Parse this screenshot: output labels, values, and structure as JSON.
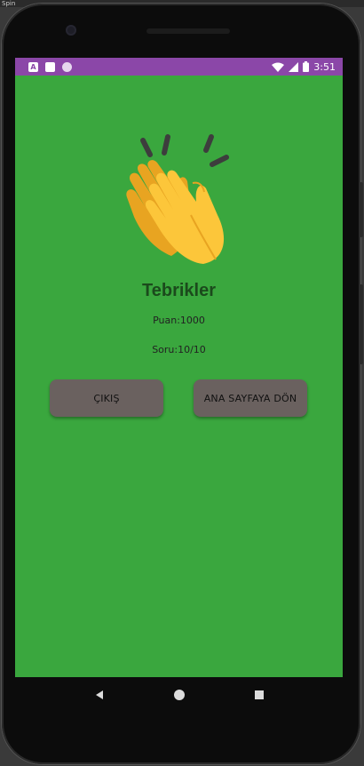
{
  "window": {
    "top_strip_label": "Spin"
  },
  "status_bar": {
    "time": "3:51",
    "notification_icons": [
      "a-letter-icon",
      "sd-card-icon",
      "sync-circle-icon"
    ],
    "system_icons": [
      "wifi-icon",
      "signal-icon",
      "battery-icon"
    ],
    "color": "#8b47a8"
  },
  "screen": {
    "background": "#3aa73e",
    "illustration": "clapping-hands-icon",
    "title": "Tebrikler",
    "score_text": "Puan:1000",
    "question_text": "Soru:10/10"
  },
  "buttons": {
    "exit_label": "ÇIKIŞ",
    "home_label": "ANA SAYFAYA DÖN",
    "color": "#6a615f"
  },
  "navigation": {
    "icons": [
      "back-icon",
      "home-circle-icon",
      "recents-icon"
    ]
  }
}
